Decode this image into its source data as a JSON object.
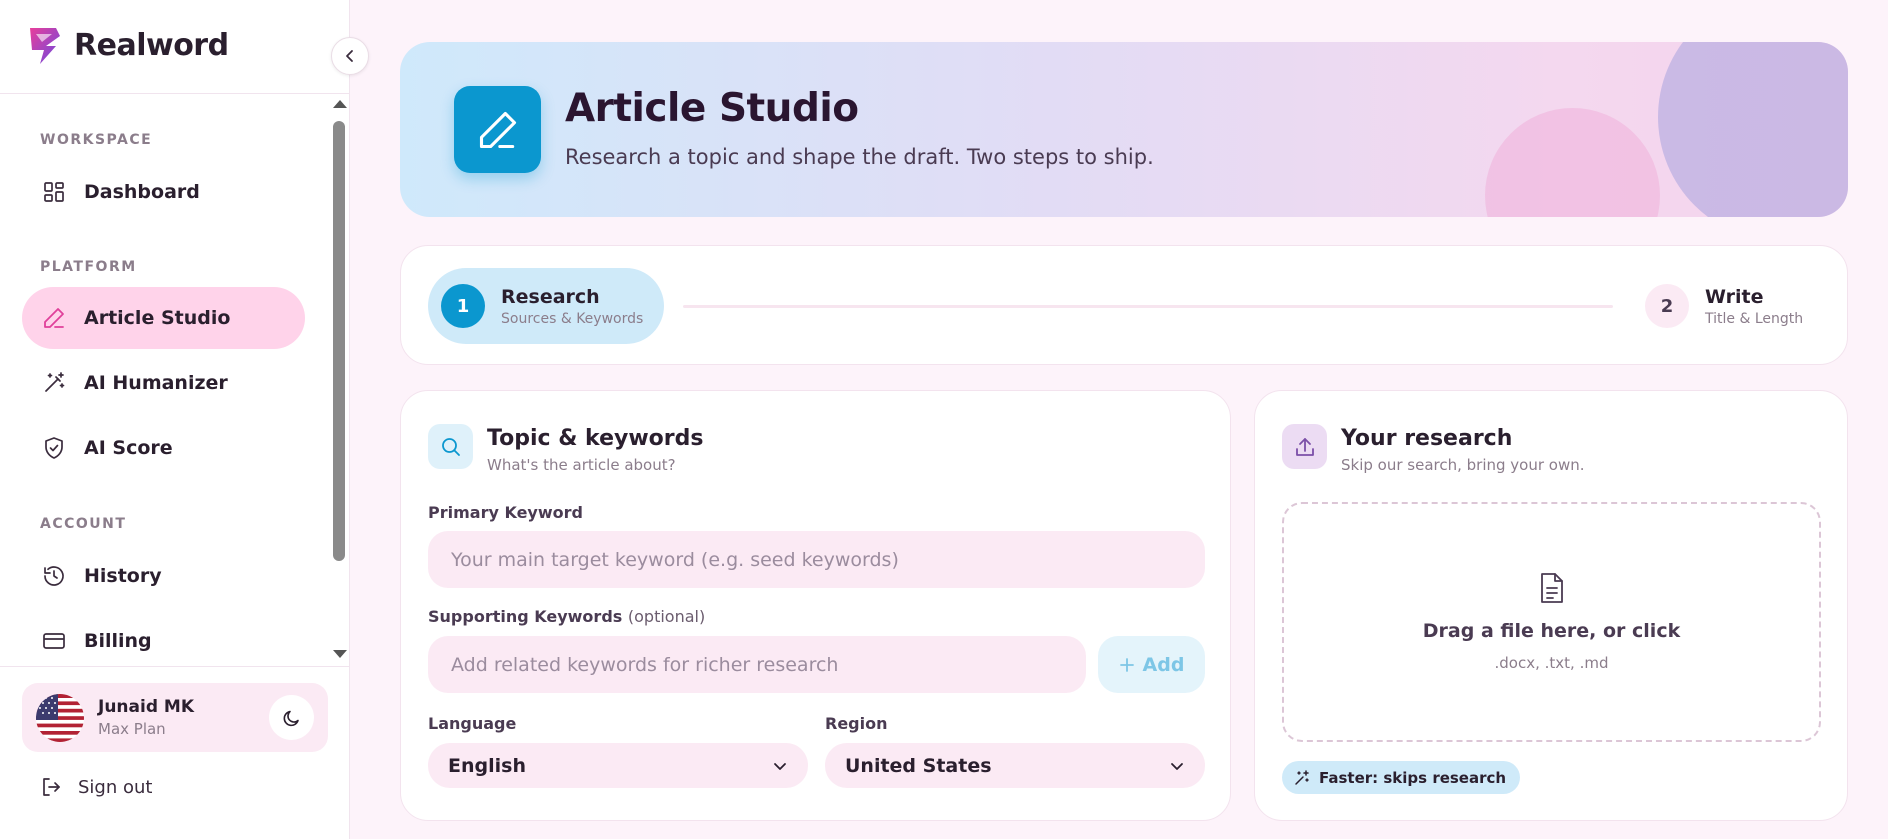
{
  "app": {
    "brand": "Realword",
    "accent": "#0b97cf",
    "active_bg": "#ffd3ea"
  },
  "sidebar": {
    "sections": [
      {
        "label": "WORKSPACE"
      },
      {
        "label": "PLATFORM"
      },
      {
        "label": "ACCOUNT"
      }
    ],
    "items": [
      {
        "label": "Dashboard",
        "icon": "grid-icon"
      },
      {
        "label": "Article Studio",
        "icon": "pencil-icon",
        "active": true
      },
      {
        "label": "AI Humanizer",
        "icon": "magic-wand-icon"
      },
      {
        "label": "AI Score",
        "icon": "shield-check-icon"
      },
      {
        "label": "History",
        "icon": "history-icon"
      },
      {
        "label": "Billing",
        "icon": "credit-card-icon"
      }
    ],
    "user": {
      "name": "Junaid MK",
      "plan": "Max Plan"
    },
    "signout_label": "Sign out"
  },
  "hero": {
    "title": "Article Studio",
    "subtitle": "Research a topic and shape the draft. Two steps to ship."
  },
  "stepper": {
    "steps": [
      {
        "num": "1",
        "title": "Research",
        "subtitle": "Sources & Keywords",
        "active": true
      },
      {
        "num": "2",
        "title": "Write",
        "subtitle": "Title & Length",
        "active": false
      }
    ]
  },
  "topic_card": {
    "title": "Topic & keywords",
    "subtitle": "What's the article about?",
    "primary_label": "Primary Keyword",
    "primary_placeholder": "Your main target keyword (e.g. seed keywords)",
    "supporting_label": "Supporting Keywords",
    "supporting_optional": "(optional)",
    "supporting_placeholder": "Add related keywords for richer research",
    "add_label": "Add",
    "language_label": "Language",
    "language_value": "English",
    "region_label": "Region",
    "region_value": "United States"
  },
  "research_card": {
    "title": "Your research",
    "subtitle": "Skip our search, bring your own.",
    "drop_title": "Drag a file here, or click",
    "drop_formats": ".docx, .txt, .md",
    "badge": "Faster: skips research"
  }
}
